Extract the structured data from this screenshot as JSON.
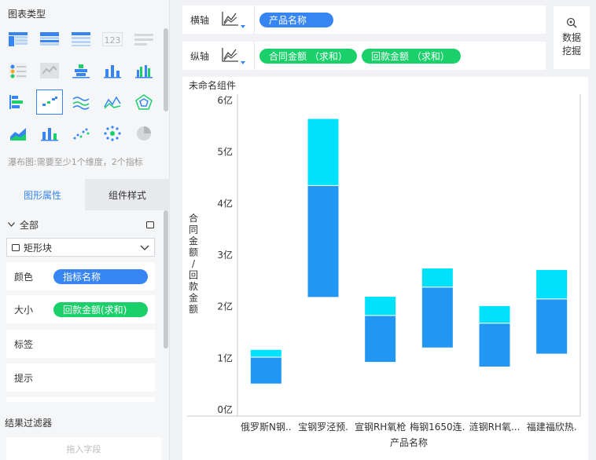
{
  "left_panel": {
    "chart_type_title": "图表类型",
    "type_hint": "瀑布图:需要至少1个维度，2个指标",
    "tabs": [
      {
        "label": "图形属性",
        "active": true
      },
      {
        "label": "组件样式",
        "active": false
      }
    ],
    "all_label": "全部",
    "shape_select": "矩形块",
    "props": [
      {
        "label": "颜色",
        "field": "指标名称",
        "color": "blue"
      },
      {
        "label": "大小",
        "field": "回款金额(求和)",
        "color": "green"
      },
      {
        "label": "标签",
        "field": ""
      },
      {
        "label": "提示",
        "field": ""
      }
    ],
    "filter_title": "结果过滤器",
    "drop_placeholder": "拖入字段"
  },
  "axes": {
    "x_label": "横轴",
    "y_label": "纵轴",
    "x_fields": [
      "产品名称"
    ],
    "y_fields": [
      "合同金额 （求和）",
      "回款金额 （求和）"
    ]
  },
  "mining_button": {
    "line1": "数据",
    "line2": "挖掘"
  },
  "widget": {
    "title": "未命名组件"
  },
  "colors": {
    "accent": "#3685f2",
    "green": "#1ad06a",
    "series_contract": "#2196f3",
    "series_payment": "#00e1fc"
  },
  "chart_data": {
    "type": "bar",
    "subtype": "waterfall-floating",
    "categories": [
      "俄罗斯N钢..",
      "宝钢罗泾预.",
      "宣钢RH氧枪",
      "梅钢1650连.",
      "涟钢RH氧...",
      "福建福欣热."
    ],
    "series": [
      {
        "name": "合同金额",
        "ranges": [
          [
            0.5,
            1.02
          ],
          [
            2.18,
            4.35
          ],
          [
            0.92,
            1.83
          ],
          [
            1.2,
            2.38
          ],
          [
            0.83,
            1.68
          ],
          [
            1.08,
            2.15
          ]
        ]
      },
      {
        "name": "回款金额",
        "ranges": [
          [
            1.02,
            1.17
          ],
          [
            4.35,
            5.65
          ],
          [
            1.83,
            2.2
          ],
          [
            2.38,
            2.75
          ],
          [
            1.68,
            2.02
          ],
          [
            2.15,
            2.72
          ]
        ]
      }
    ],
    "xlabel": "产品名称",
    "ylabel": "合同金额/回款金额",
    "yticks": [
      "0亿",
      "1亿",
      "2亿",
      "3亿",
      "4亿",
      "5亿",
      "6亿"
    ],
    "ylim": [
      0,
      6
    ],
    "grid": false
  }
}
